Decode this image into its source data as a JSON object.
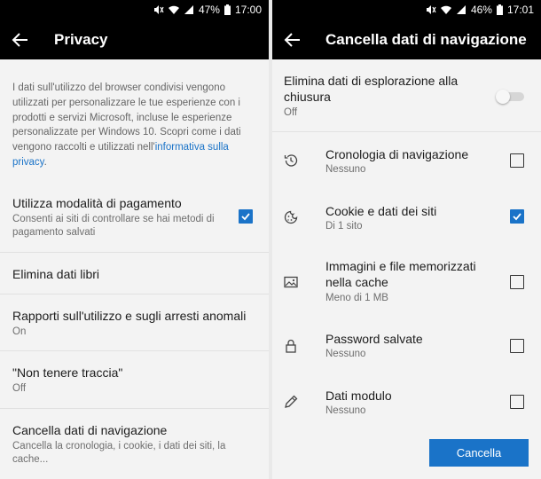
{
  "left": {
    "status": {
      "battery": "47%",
      "time": "17:00"
    },
    "title": "Privacy",
    "description": "I dati sull'utilizzo del browser condivisi vengono utilizzati per personalizzare le tue esperienze con i prodotti e servizi Microsoft, incluse le esperienze personalizzate per Windows 10. Scopri come i dati vengono raccolti e utilizzati nell'",
    "description_link": "informativa sulla privacy",
    "description_end": ".",
    "items": [
      {
        "title": "Utilizza modalità di pagamento",
        "subtitle": "Consenti ai siti di controllare se hai metodi di pagamento salvati",
        "checked": true
      },
      {
        "title": "Elimina dati libri"
      },
      {
        "title": "Rapporti sull'utilizzo e sugli arresti anomali",
        "subtitle": "On"
      },
      {
        "title": "\"Non tenere traccia\"",
        "subtitle": "Off"
      },
      {
        "title": "Cancella dati di navigazione",
        "subtitle": "Cancella la cronologia, i cookie, i dati dei siti, la cache..."
      }
    ]
  },
  "right": {
    "status": {
      "battery": "46%",
      "time": "17:01"
    },
    "title": "Cancella dati di navigazione",
    "close_setting": {
      "title": "Elimina dati di esplorazione alla chiusura",
      "subtitle": "Off"
    },
    "items": [
      {
        "title": "Cronologia di navigazione",
        "subtitle": "Nessuno",
        "icon": "history-icon",
        "checked": false
      },
      {
        "title": "Cookie e dati dei siti",
        "subtitle": "Di 1 sito",
        "icon": "cookie-icon",
        "checked": true
      },
      {
        "title": "Immagini e file memorizzati nella cache",
        "subtitle": "Meno di 1 MB",
        "icon": "image-icon",
        "checked": false
      },
      {
        "title": "Password salvate",
        "subtitle": "Nessuno",
        "icon": "lock-icon",
        "checked": false
      },
      {
        "title": "Dati modulo",
        "subtitle": "Nessuno",
        "icon": "pencil-icon",
        "checked": false
      }
    ],
    "button": "Cancella"
  },
  "colors": {
    "accent": "#1a73c8",
    "appbar": "#000000",
    "background": "#f3f3f3"
  }
}
